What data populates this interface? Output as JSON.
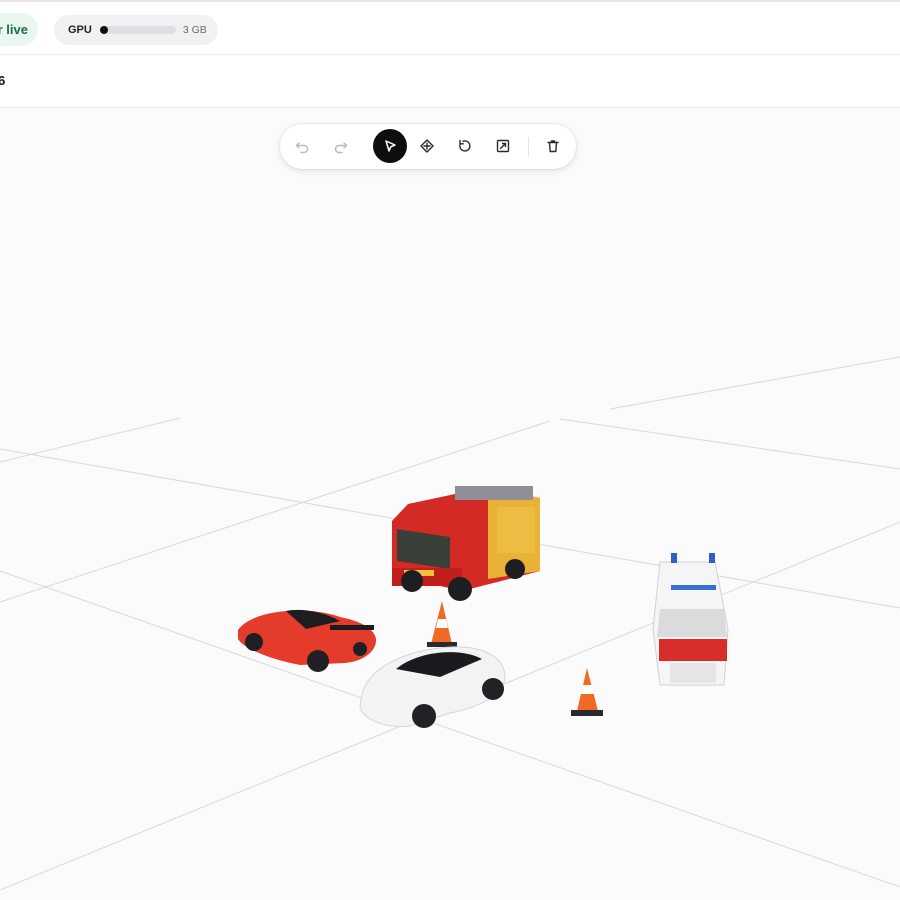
{
  "header": {
    "status_label": "r live",
    "gpu_label": "GPU",
    "gpu_usage_fraction": 0.07,
    "gpu_value": "3 GB"
  },
  "subheader": {
    "title": "6"
  },
  "toolbar": {
    "tools": [
      {
        "icon": "undo-icon",
        "enabled": false
      },
      {
        "icon": "redo-icon",
        "enabled": false
      },
      {
        "icon": "select-cursor-icon",
        "active": true
      },
      {
        "icon": "move-icon"
      },
      {
        "icon": "rotate-icon"
      },
      {
        "icon": "scale-icon"
      },
      {
        "icon": "trash-icon"
      }
    ]
  },
  "scene": {
    "objects": [
      "fire-truck",
      "sports-car",
      "traffic-cone",
      "white-sedan",
      "traffic-cone",
      "ambulance-van"
    ]
  },
  "colors": {
    "active_tool": "#0e0e10",
    "status_bg": "#e8f7ef",
    "status_text": "#1f6b45"
  }
}
